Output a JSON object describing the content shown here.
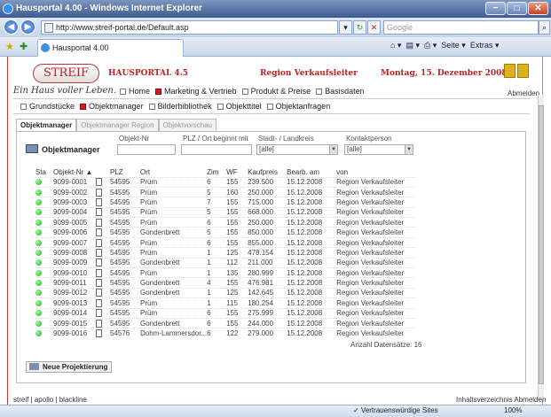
{
  "window": {
    "title": "Hausportal 4.00 - Windows Internet Explorer",
    "minimize": "−",
    "maximize": "□",
    "close": "✕"
  },
  "browser": {
    "url": "http://www.streif-portal.de/Default.asp",
    "search_placeholder": "Google",
    "tab_title": "Hausportal 4.00",
    "tools": [
      "Seite ▾",
      "Extras ▾"
    ]
  },
  "site": {
    "logo": "STREIF",
    "tagline": "Ein Haus voller Leben.",
    "portal": "HAUSPORTAL 4.5",
    "region": "Region Verkaufsleiter",
    "date": "Montag, 15. Dezember 2008",
    "abmelden": "Abmelden"
  },
  "topnav": [
    {
      "label": "Home",
      "checked": false
    },
    {
      "label": "Marketing & Vertrieb",
      "checked": true
    },
    {
      "label": "Produkt & Preise",
      "checked": false
    },
    {
      "label": "Basisdaten",
      "checked": false
    }
  ],
  "subnav": [
    {
      "label": "Grundstücke",
      "checked": false
    },
    {
      "label": "Objektmanager",
      "checked": true
    },
    {
      "label": "Bilderbibliothek",
      "checked": false
    },
    {
      "label": "Objekttitel",
      "checked": false
    },
    {
      "label": "Objektanfragen",
      "checked": false
    }
  ],
  "subtabs": [
    "Objektmanager",
    "Objektmanager Region",
    "Objektvorschau"
  ],
  "panel": {
    "title": "Objektmanager",
    "filters": {
      "objekt_nr": {
        "label": "Objekt-Nr",
        "value": ""
      },
      "plz": {
        "label": "PLZ / Ort beginnt mit",
        "value": ""
      },
      "stadt": {
        "label": "Stadt- / Landkreis",
        "value": "[alle]"
      },
      "kontakt": {
        "label": "Kontaktperson",
        "value": "[alle]"
      }
    },
    "columns": [
      "Sta",
      "Objekt-Nr ▲",
      "",
      "PLZ",
      "Ort",
      "Zim",
      "WF",
      "Kaufpreis",
      "Bearb. am",
      "von"
    ],
    "rows": [
      [
        "9099-0001",
        "54595",
        "Prüm",
        "6",
        "155",
        "239.500",
        "15.12.2008",
        "Region Verkaufsleiter"
      ],
      [
        "9099-0002",
        "54595",
        "Prüm",
        "5",
        "160",
        "250.000",
        "15.12.2008",
        "Region Verkaufsleiter"
      ],
      [
        "9099-0003",
        "54595",
        "Prüm",
        "7",
        "155",
        "715.000",
        "15.12.2008",
        "Region Verkaufsleiter"
      ],
      [
        "9099-0004",
        "54595",
        "Prüm",
        "5",
        "155",
        "668.000",
        "15.12.2008",
        "Region Verkaufsleiter"
      ],
      [
        "9099-0005",
        "54595",
        "Prüm",
        "6",
        "155",
        "250.000",
        "15.12.2008",
        "Region Verkaufsleiter"
      ],
      [
        "9099-0006",
        "54595",
        "Gondenbrett",
        "5",
        "155",
        "850.000",
        "15.12.2008",
        "Region Verkaufsleiter"
      ],
      [
        "9099-0007",
        "54595",
        "Prüm",
        "6",
        "155",
        "855.000",
        "15.12.2008",
        "Region Verkaufsleiter"
      ],
      [
        "9099-0008",
        "54595",
        "Prüm",
        "1",
        "125",
        "478.154",
        "15.12.2008",
        "Region Verkaufsleiter"
      ],
      [
        "9099-0009",
        "54595",
        "Gondenbrett",
        "1",
        "112",
        "211.000",
        "15.12.2008",
        "Region Verkaufsleiter"
      ],
      [
        "9099-0010",
        "54595",
        "Prüm",
        "1",
        "135",
        "280.999",
        "15.12.2008",
        "Region Verkaufsleiter"
      ],
      [
        "9099-0011",
        "54595",
        "Gondenbrett",
        "4",
        "155",
        "476.981",
        "15.12.2008",
        "Region Verkaufsleiter"
      ],
      [
        "9099-0012",
        "54595",
        "Gondenbrett",
        "1",
        "125",
        "142.645",
        "15.12.2008",
        "Region Verkaufsleiter"
      ],
      [
        "9099-0013",
        "54595",
        "Prüm",
        "1",
        "115",
        "180.254",
        "15.12.2008",
        "Region Verkaufsleiter"
      ],
      [
        "9099-0014",
        "54595",
        "Prüm",
        "6",
        "155",
        "275.999",
        "15.12.2008",
        "Region Verkaufsleiter"
      ],
      [
        "9099-0015",
        "54595",
        "Gondenbrett",
        "6",
        "155",
        "244.000",
        "15.12.2008",
        "Region Verkaufsleiter"
      ],
      [
        "9099-0016",
        "54576",
        "Dohm-Lammersdor...",
        "6",
        "122",
        "279.000",
        "15.12.2008",
        "Region Verkaufsleiter"
      ]
    ],
    "count_label": "Anzahl Datensätze: 16",
    "new_button": "Neue Projektierung"
  },
  "footer": {
    "left": "streif | apollo | blackline",
    "right": "Inhaltsverzeichnis  Abmelden"
  },
  "statusbar": {
    "trusted": "✓ Vertrauenswürdige Sites",
    "zoom": "100%"
  }
}
